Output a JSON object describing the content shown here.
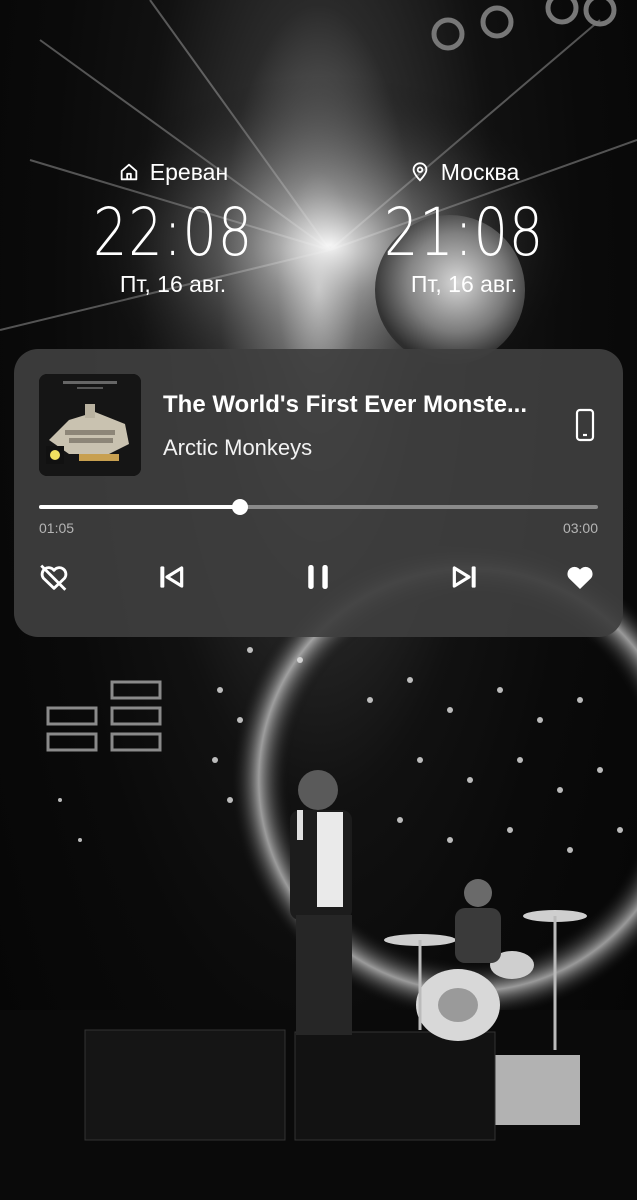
{
  "clocks": [
    {
      "city": "Ереван",
      "icon": "home-icon",
      "time": "22:08",
      "date": "Пт, 16 авг."
    },
    {
      "city": "Москва",
      "icon": "location-pin-icon",
      "time": "21:08",
      "date": "Пт, 16 авг."
    }
  ],
  "media": {
    "title": "The World's First Ever Monste...",
    "artist": "Arctic Monkeys",
    "elapsed": "01:05",
    "total": "03:00",
    "progress_fraction": 0.36,
    "controls": {
      "dislike_icon": "broken-heart-icon",
      "previous_icon": "skip-previous-icon",
      "play_pause_icon": "pause-icon",
      "next_icon": "skip-next-icon",
      "like_icon": "heart-icon",
      "output_icon": "phone-device-icon"
    }
  },
  "colors": {
    "card_background": "#3e3e3e",
    "progress_played": "#ffffff",
    "progress_remaining": "#8a8a8a",
    "text_primary": "#ffffff",
    "text_secondary": "#b5b5b5"
  }
}
